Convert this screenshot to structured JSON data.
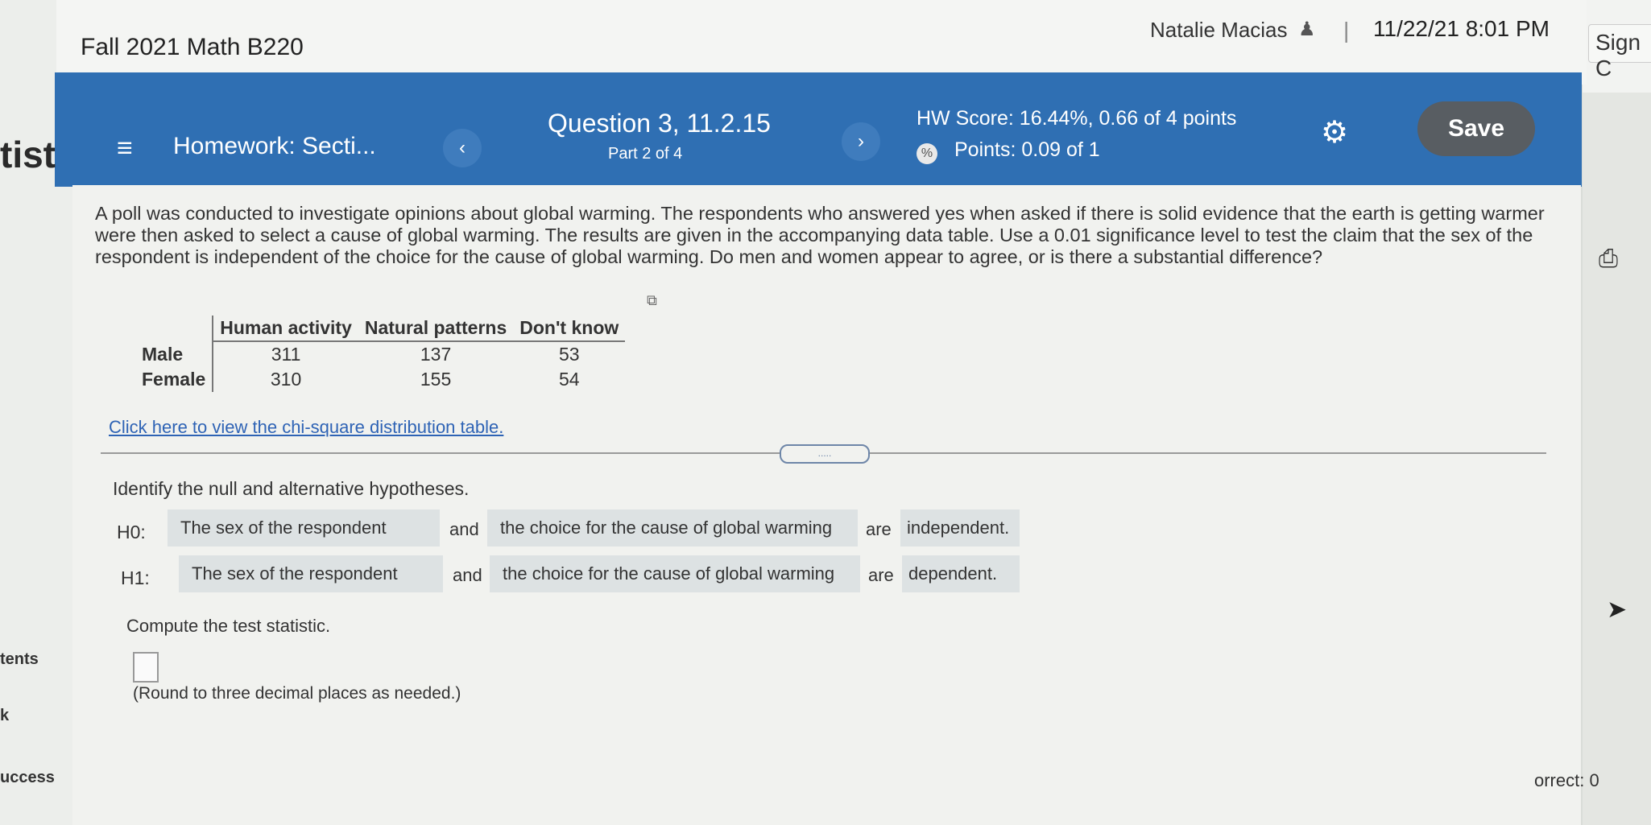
{
  "background": {
    "left_items": [
      "tents",
      "k",
      "uccess"
    ]
  },
  "topbar": {
    "course_title": "Fall 2021 Math B220",
    "user_name": "Natalie Macias",
    "separator": "|",
    "datetime": "11/22/21 8:01 PM",
    "sign_out": "Sign C"
  },
  "header": {
    "side_text": "tist",
    "menu_icon": "≡",
    "title": "Homework: Secti...",
    "prev": "‹",
    "next": "›",
    "question_title": "Question 3, 11.2.15",
    "question_part": "Part 2 of 4",
    "hw_score": "HW Score: 16.44%, 0.66 of 4 points",
    "points": "Points: 0.09 of 1",
    "save_label": "Save",
    "icons": {
      "menu": "hamburger-icon",
      "gear": "gear-icon",
      "points": "partial-credit-icon"
    }
  },
  "question": {
    "text": "A poll was conducted to investigate opinions about global warming. The respondents who answered yes when asked if there is solid evidence that the earth is getting warmer were then asked to select a cause of global warming. The results are given in the accompanying data table. Use a 0.01 significance level to test the claim that the sex of the respondent is independent of the choice for the cause of global warming. Do men and women appear to agree, or is there a substantial difference?",
    "table": {
      "headers": [
        "Human activity",
        "Natural patterns",
        "Don't know"
      ],
      "rows": [
        {
          "label": "Male",
          "values": [
            "311",
            "137",
            "53"
          ]
        },
        {
          "label": "Female",
          "values": [
            "310",
            "155",
            "54"
          ]
        }
      ]
    },
    "chi_link": "Click here to view the chi-square distribution table.",
    "separator_handle": "....."
  },
  "answer": {
    "instruction_hyp": "Identify the null and alternative hypotheses.",
    "h0": {
      "label": "H0:",
      "subject": "The sex of the respondent",
      "and": "and",
      "object": "the choice for the cause of global warming",
      "are": "are",
      "relation": "independent."
    },
    "h1": {
      "label": "H1:",
      "subject": "The sex of the respondent",
      "and": "and",
      "object": "the choice for the cause of global warming",
      "are": "are",
      "relation": "dependent."
    },
    "instruction_compute": "Compute the test statistic.",
    "round_note": "(Round to three decimal places as needed.)"
  },
  "footer": {
    "correct": "orrect: 0"
  }
}
